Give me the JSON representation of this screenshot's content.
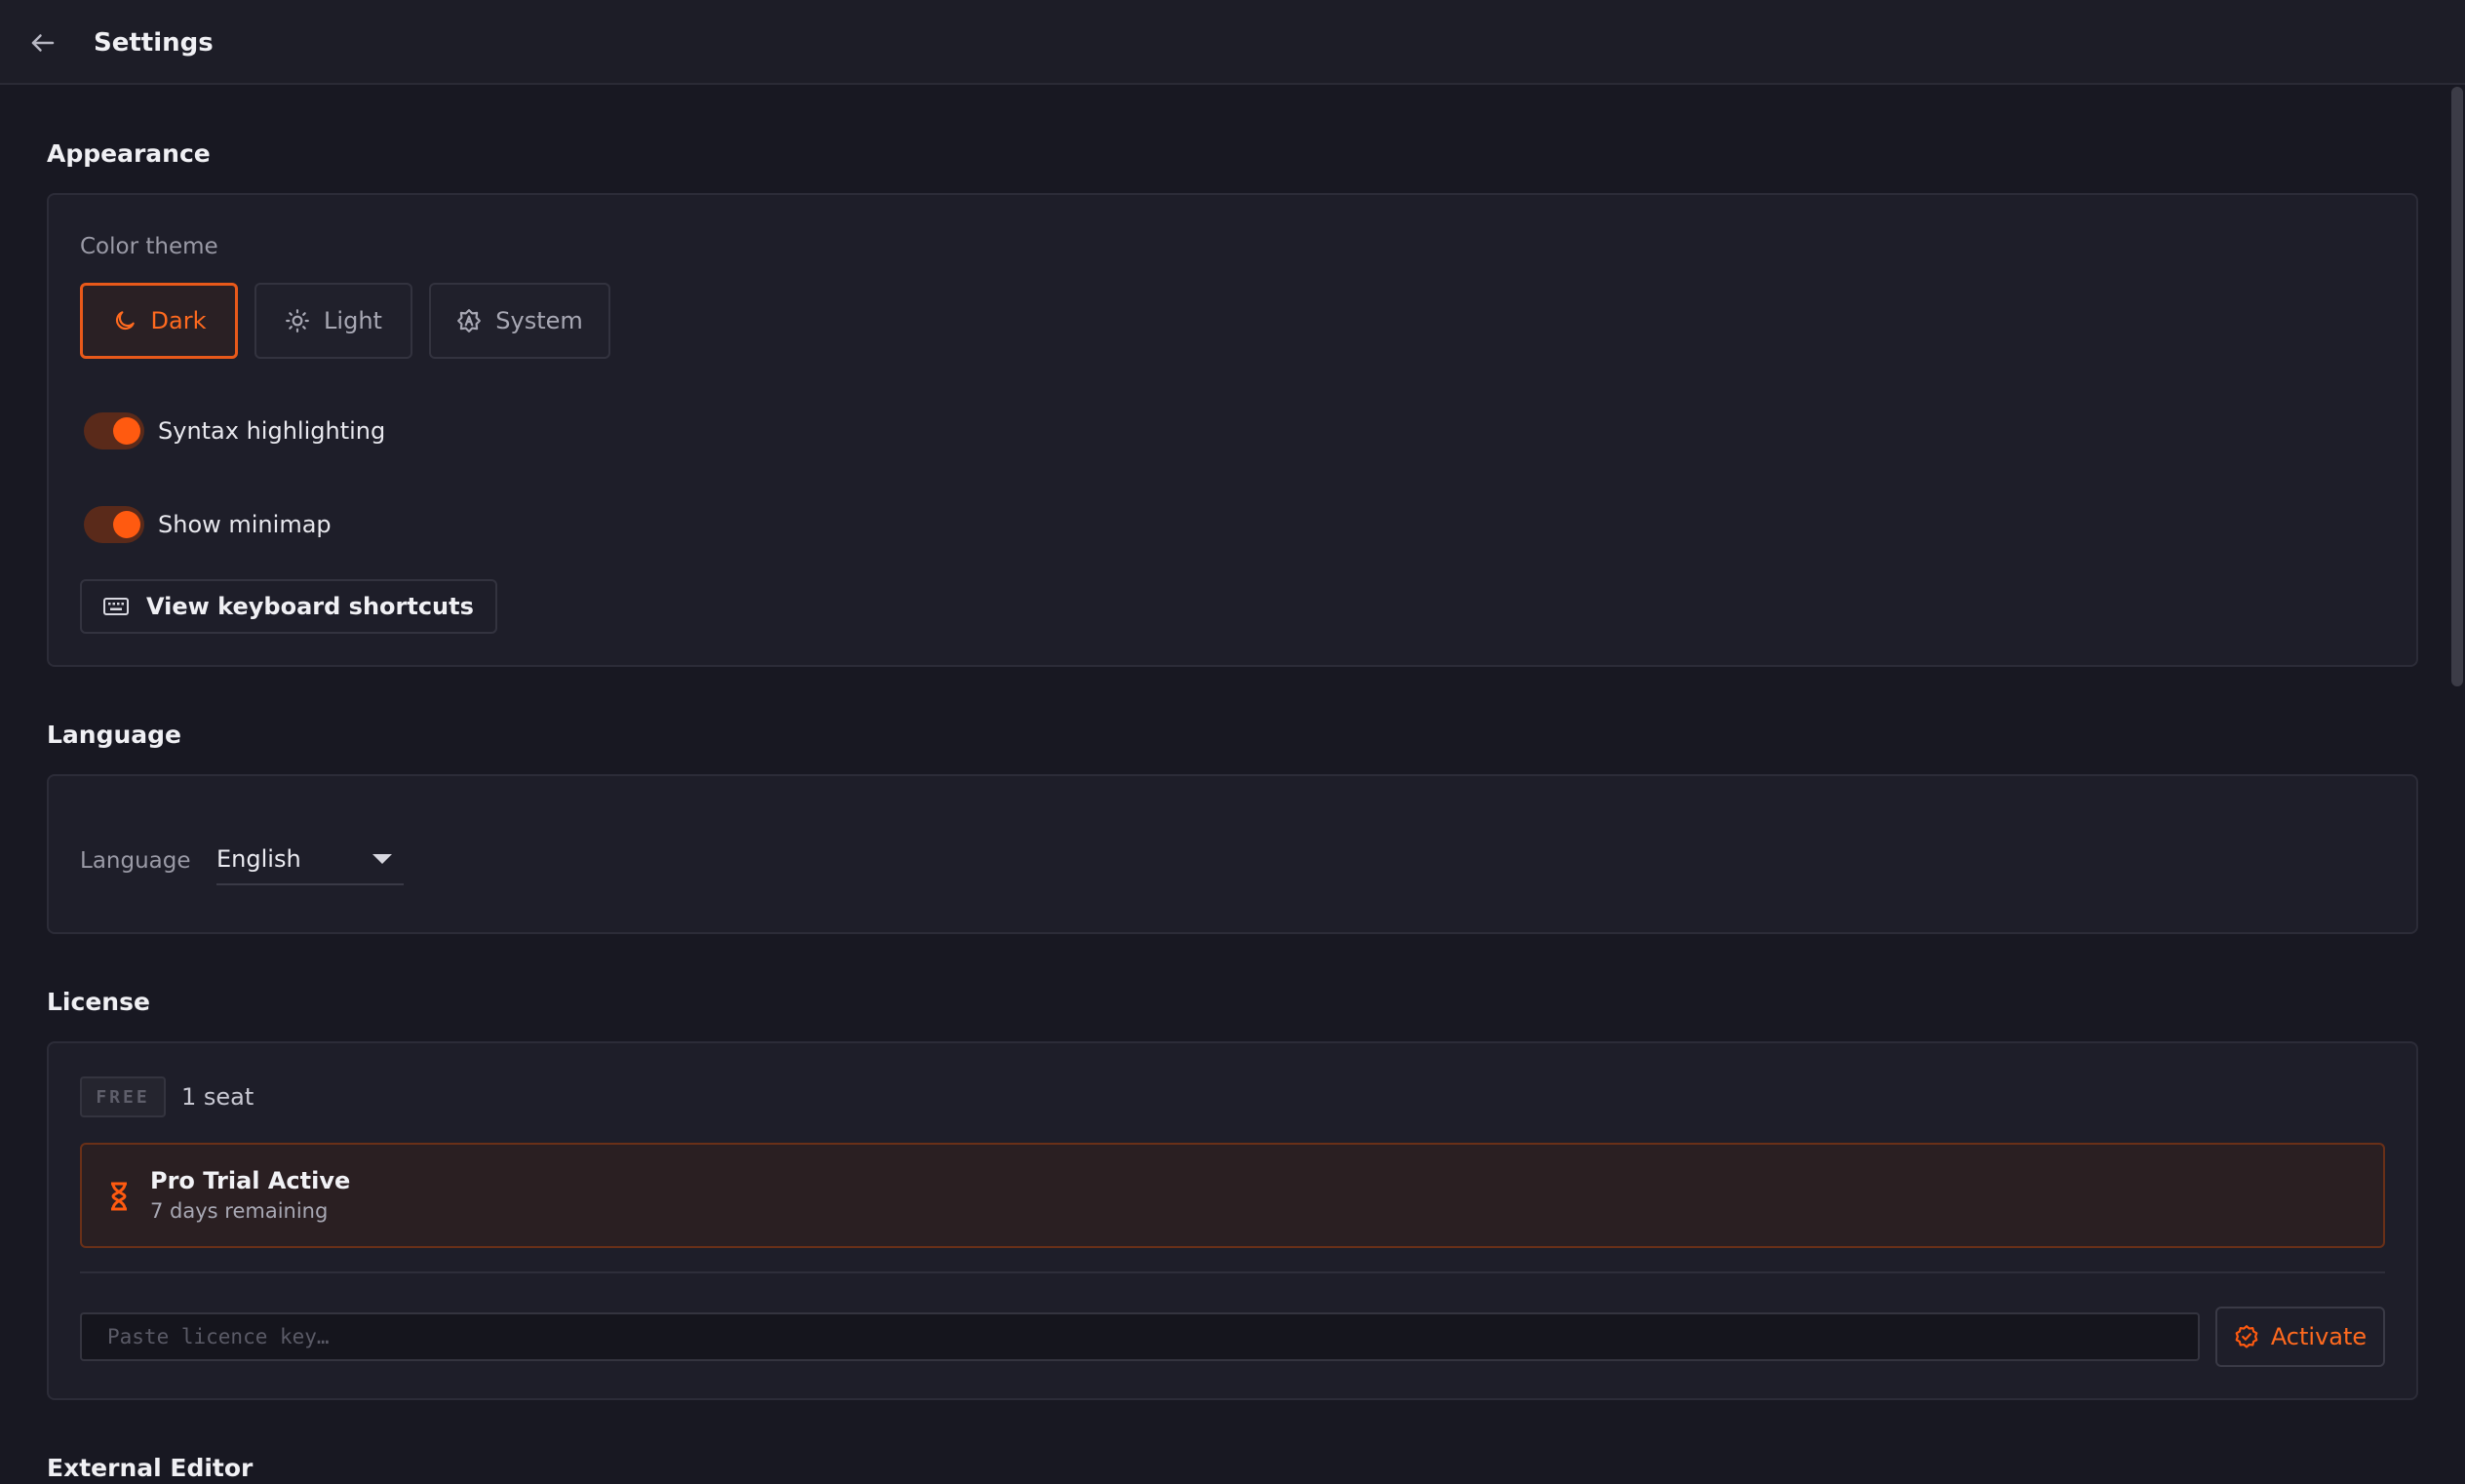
{
  "header": {
    "title": "Settings"
  },
  "appearance": {
    "section_title": "Appearance",
    "color_theme_label": "Color theme",
    "themes": [
      {
        "label": "Dark",
        "icon": "moon-icon",
        "active": true
      },
      {
        "label": "Light",
        "icon": "sun-icon",
        "active": false
      },
      {
        "label": "System",
        "icon": "system-icon",
        "active": false
      }
    ],
    "toggles": [
      {
        "label": "Syntax highlighting",
        "on": true
      },
      {
        "label": "Show minimap",
        "on": true
      }
    ],
    "shortcuts_button": "View keyboard shortcuts"
  },
  "language": {
    "section_title": "Language",
    "field_label": "Language",
    "selected": "English"
  },
  "license": {
    "section_title": "License",
    "badge": "FREE",
    "seats": "1 seat",
    "trial_title": "Pro Trial Active",
    "trial_remaining": "7 days remaining",
    "key_placeholder": "Paste licence key…",
    "activate_label": "Activate"
  },
  "external_editor": {
    "section_title": "External Editor"
  },
  "colors": {
    "accent": "#ff5a10",
    "background": "#181822",
    "card": "#1e1e29"
  }
}
